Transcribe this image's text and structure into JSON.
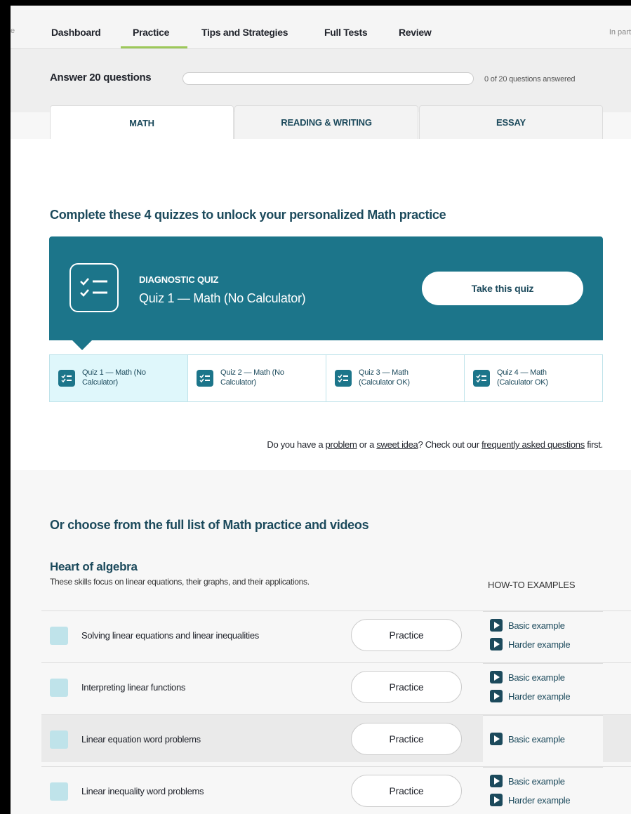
{
  "nav": {
    "edge_fragment": "e",
    "items": [
      "Dashboard",
      "Practice",
      "Tips and Strategies",
      "Full Tests",
      "Review"
    ],
    "partner_text": "In part"
  },
  "progress": {
    "label": "Answer 20 questions",
    "answered": 0,
    "total": 20,
    "fraction": 0,
    "count_text": "0 of 20 questions answered"
  },
  "tabs": [
    {
      "label": "MATH",
      "active": true
    },
    {
      "label": "READING & WRITING",
      "active": false
    },
    {
      "label": "ESSAY",
      "active": false
    }
  ],
  "unlock": {
    "heading": "Complete these 4 quizzes to unlock your personalized Math practice",
    "card": {
      "tag": "DIAGNOSTIC QUIZ",
      "title": "Quiz 1 — Math (No Calculator)",
      "button": "Take this quiz"
    },
    "quizzes": [
      "Quiz 1 — Math (No Calculator)",
      "Quiz 2 — Math (No Calculator)",
      "Quiz 3 — Math (Calculator OK)",
      "Quiz 4 — Math (Calculator OK)"
    ],
    "help": {
      "t1": "Do you have a ",
      "problem": "problem",
      "t2": " or a ",
      "idea": "sweet idea",
      "t3": "? Check out our ",
      "faq": "frequently asked questions",
      "t4": " first."
    }
  },
  "full_list": {
    "heading": "Or choose from the full list of Math practice and videos",
    "section": {
      "title": "Heart of algebra",
      "description": "These skills focus on linear equations, their graphs, and their applications.",
      "howto_heading": "HOW-TO EXAMPLES",
      "practice_label": "Practice",
      "skills": [
        {
          "name": "Solving linear equations and linear inequalities",
          "examples": [
            "Basic example",
            "Harder example"
          ]
        },
        {
          "name": "Interpreting linear functions",
          "examples": [
            "Basic example",
            "Harder example"
          ]
        },
        {
          "name": "Linear equation word problems",
          "examples": [
            "Basic example"
          ]
        },
        {
          "name": "Linear inequality word problems",
          "examples": [
            "Basic example",
            "Harder example"
          ]
        }
      ]
    }
  },
  "colors": {
    "accent": "#1c758a",
    "dark_teal": "#1c4a5c",
    "nav_underline": "#9dc85a",
    "tile_active": "#dff7fb"
  }
}
